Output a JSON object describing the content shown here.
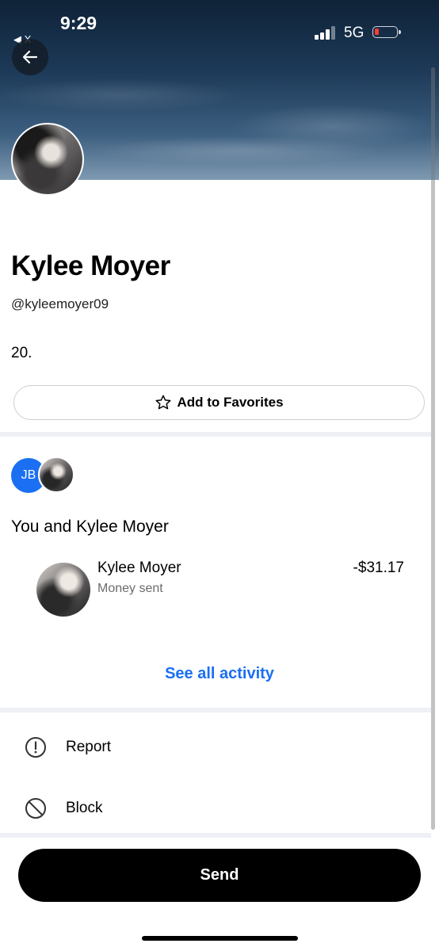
{
  "status_bar": {
    "time": "9:29",
    "back_app": "◀ X",
    "network": "5G",
    "battery_color": "#ff3b30"
  },
  "header": {
    "back_icon": "arrow-left-icon"
  },
  "profile": {
    "name": "Kylee Moyer",
    "handle": "@kyleemoyer09",
    "bio": "20.",
    "favorite_label": "Add to Favorites",
    "favorite_icon": "star-outline-icon"
  },
  "activity": {
    "user_initials": "JB",
    "title": "You and Kylee Moyer",
    "transactions": [
      {
        "name": "Kylee Moyer",
        "description": "Money sent",
        "amount": "-$31.17"
      }
    ],
    "see_all_label": "See all activity"
  },
  "menu": {
    "items": [
      {
        "label": "Report",
        "icon": "alert-circle-icon"
      },
      {
        "label": "Block",
        "icon": "block-icon"
      }
    ]
  },
  "footer": {
    "send_label": "Send"
  },
  "colors": {
    "accent": "#1a6ff2",
    "divider": "#eef0f6",
    "send_button": "#000000"
  }
}
